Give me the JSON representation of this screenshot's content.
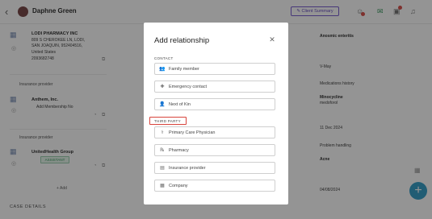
{
  "header": {
    "patient_name": "Daphne Green",
    "summary_button": "Client Summary",
    "notification_badge": "1",
    "message_badge": "9"
  },
  "left_column": {
    "pharmacy": {
      "name": "LODI PHARMACY INC",
      "address_1": "809 S CHEROKEE LN, LODI,",
      "address_2": "SAN JOAQUIN, 952404516,",
      "country": "United States",
      "phone": "2093682748"
    },
    "insurance_section_1": "Insurance provider",
    "insurance_1": {
      "name": "Anthem, Inc.",
      "add_link": "Add Membership No"
    },
    "insurance_section_2": "Insurance provider",
    "insurance_2": {
      "name": "UnitedHealth Group",
      "tag": "ASSISTANT"
    },
    "add_label": "Add",
    "case_details": "CASE DETAILS"
  },
  "right_column": {
    "item_1": "Anosmic enteritis",
    "item_2": "V-May",
    "item_3_label": "Medications history",
    "item_4": "Minocycline",
    "item_5": "medoforol",
    "item_6": "11 Dec 2024",
    "item_7_label": "Problem handling",
    "item_8": "Acne",
    "item_9": "04/08/2024"
  },
  "modal": {
    "title": "Add relationship",
    "contact_label": "CONTACT",
    "contact_options": [
      {
        "icon": "person-icon",
        "glyph": "👥",
        "label": "Family member"
      },
      {
        "icon": "emergency-icon",
        "glyph": "✚",
        "label": "Emergency contact"
      },
      {
        "icon": "person-icon",
        "glyph": "👤",
        "label": "Next of Kin"
      }
    ],
    "third_party_label": "THIRD PARTY",
    "third_party_options": [
      {
        "icon": "stethoscope-icon",
        "glyph": "⚕",
        "label": "Primary Care Physician"
      },
      {
        "icon": "pharmacy-icon",
        "glyph": "℞",
        "label": "Pharmacy"
      },
      {
        "icon": "insurance-icon",
        "glyph": "▤",
        "label": "Insurance provider"
      },
      {
        "icon": "company-icon",
        "glyph": "▦",
        "label": "Company"
      }
    ]
  },
  "colors": {
    "accent": "#6a4fc0",
    "highlight": "#d8433b",
    "fab": "#3aa0c9"
  }
}
